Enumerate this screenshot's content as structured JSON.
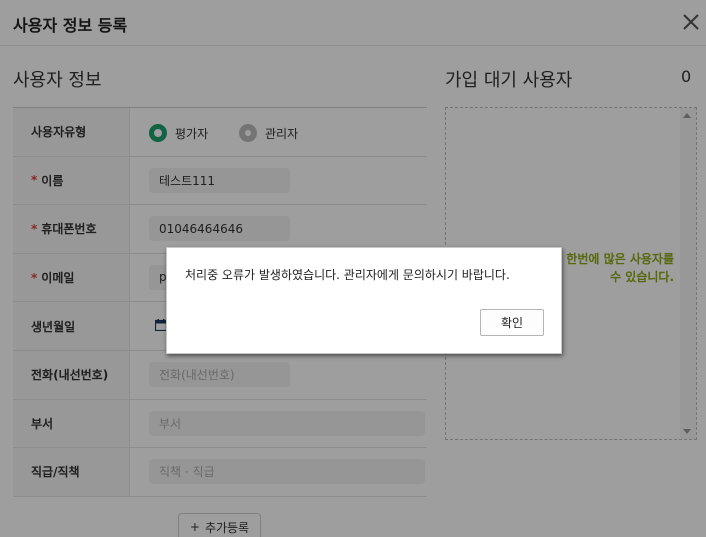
{
  "header": {
    "title": "사용자 정보 등록",
    "close_icon": "close-icon"
  },
  "user_info": {
    "title": "사용자 정보",
    "rows": {
      "user_type": {
        "label": "사용자유형",
        "options": [
          {
            "label": "평가자",
            "selected": true
          },
          {
            "label": "관리자",
            "selected": false
          }
        ]
      },
      "name": {
        "label": "이름",
        "required": "*",
        "value": "테스트111"
      },
      "phone": {
        "label": "휴대폰번호",
        "required": "*",
        "value": "01046464646"
      },
      "email": {
        "label": "이메일",
        "required": "*",
        "value": "p"
      },
      "birth": {
        "label": "생년월일",
        "icon": "calendar-icon"
      },
      "tel": {
        "label": "전화(내선번호)",
        "placeholder": "전화(내선번호)"
      },
      "dept": {
        "label": "부서",
        "placeholder": "부서"
      },
      "position": {
        "label": "직급/직책",
        "placeholder": "직책 · 직급"
      }
    },
    "add_button": {
      "icon": "+",
      "label": "추가등록"
    }
  },
  "pending": {
    "title": "가입 대기 사용자",
    "count": "0",
    "message_line1": "한번에 많은 사용자를",
    "message_line2": "수 있습니다."
  },
  "dialog": {
    "message": "처리중 오류가 발생하였습니다. 관리자에게 문의하시기 바랍니다.",
    "ok_label": "확인"
  },
  "colors": {
    "accent_green": "#1aa06d",
    "required_red": "#d9413a",
    "notice_olive": "#8aa814"
  }
}
